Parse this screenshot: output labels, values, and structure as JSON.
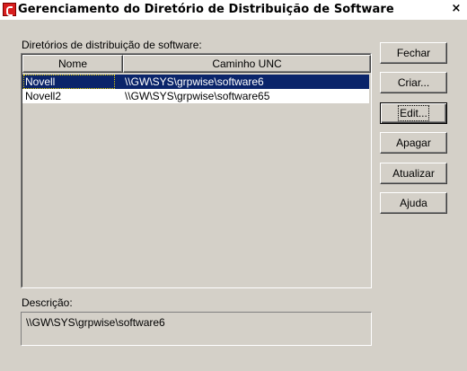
{
  "window": {
    "title": "Gerenciamento do Diretório de Distribuição de Software",
    "close_glyph": "×"
  },
  "list": {
    "label": "Diretórios de distribuição de software:",
    "columns": [
      "Nome",
      "Caminho UNC"
    ],
    "rows": [
      {
        "name": "Novell",
        "path": "\\\\GW\\SYS\\grpwise\\software6",
        "selected": true
      },
      {
        "name": "Novell2",
        "path": "\\\\GW\\SYS\\grpwise\\software65",
        "selected": false
      }
    ]
  },
  "buttons": {
    "close": "Fechar",
    "create": "Criar...",
    "edit": "Edit...",
    "delete": "Apagar",
    "refresh": "Atualizar",
    "help": "Ajuda"
  },
  "description": {
    "label": "Descrição:",
    "value": "\\\\GW\\SYS\\grpwise\\software6"
  },
  "colors": {
    "face": "#d4d0c8",
    "selection": "#0a246a",
    "app_icon": "#d81e1e"
  }
}
